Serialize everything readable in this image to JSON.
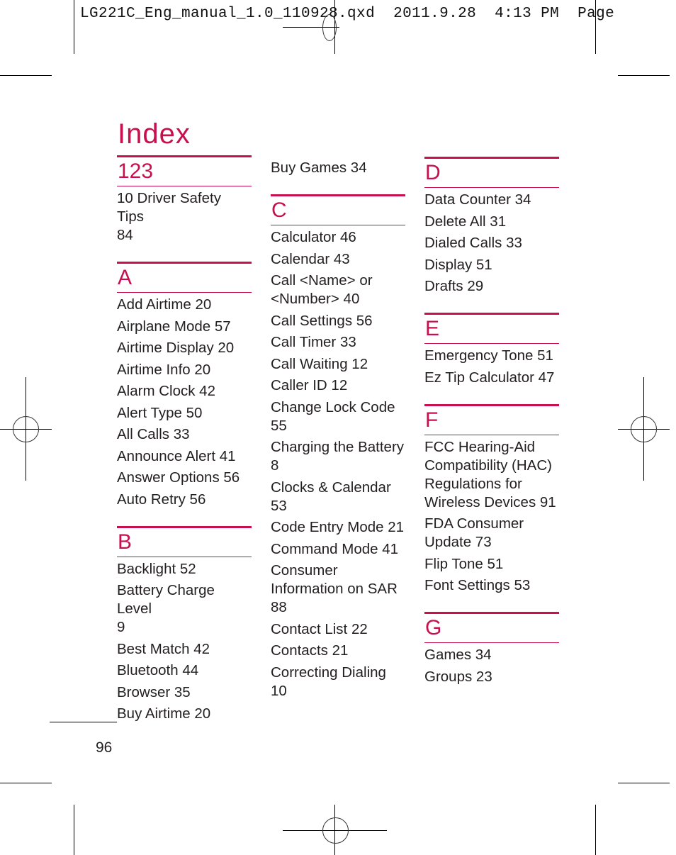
{
  "slug_line": "LG221C_Eng_manual_1.0_110928.qxd  2011.9.28  4:13 PM  Page",
  "title": "Index",
  "colors": {
    "accent": "#c8104e",
    "text": "#231f20"
  },
  "page_number": "96",
  "columns": [
    {
      "sections": [
        {
          "letter": "123",
          "entries": [
            "10 Driver Safety Tips\n84"
          ]
        },
        {
          "letter": "A",
          "entries": [
            "Add Airtime 20",
            "Airplane Mode 57",
            "Airtime Display 20",
            "Airtime Info 20",
            "Alarm Clock 42",
            "Alert Type 50",
            "All Calls 33",
            "Announce Alert 41",
            "Answer Options 56",
            "Auto Retry 56"
          ]
        },
        {
          "letter": "B",
          "entries": [
            "Backlight 52",
            "Battery Charge Level\n9",
            "Best Match 42",
            "Bluetooth 44",
            "Browser 35",
            "Buy Airtime 20"
          ]
        }
      ]
    },
    {
      "continued": [
        "Buy Games 34"
      ],
      "sections": [
        {
          "letter": "C",
          "entries": [
            "Calculator 46",
            "Calendar 43",
            "Call <Name> or\n<Number> 40",
            "Call Settings 56",
            "Call Timer 33",
            "Call Waiting 12",
            "Caller ID 12",
            "Change Lock Code\n55",
            "Charging the Battery\n8",
            "Clocks & Calendar\n53",
            "Code Entry Mode 21",
            "Command Mode 41",
            "Consumer\nInformation on SAR\n88",
            "Contact List 22",
            "Contacts 21",
            "Correcting Dialing\n10"
          ]
        }
      ]
    },
    {
      "sections": [
        {
          "letter": "D",
          "entries": [
            "Data Counter 34",
            "Delete All 31",
            "Dialed Calls 33",
            "Display 51",
            "Drafts 29"
          ]
        },
        {
          "letter": "E",
          "entries": [
            "Emergency Tone 51",
            "Ez Tip Calculator 47"
          ]
        },
        {
          "letter": "F",
          "entries": [
            "FCC Hearing-Aid\nCompatibility (HAC)\nRegulations for\nWireless Devices 91",
            "FDA Consumer\nUpdate 73",
            "Flip Tone 51",
            "Font Settings 53"
          ]
        },
        {
          "letter": "G",
          "entries": [
            "Games 34",
            "Groups 23"
          ]
        }
      ]
    }
  ]
}
